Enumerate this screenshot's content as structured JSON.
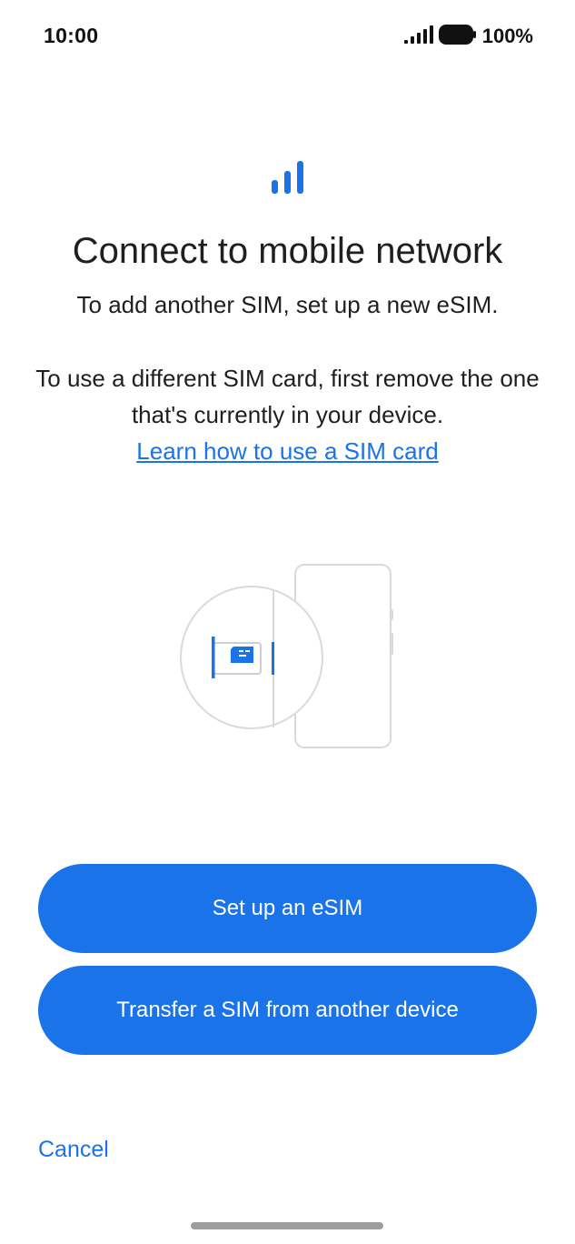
{
  "status_bar": {
    "time": "10:00",
    "battery": "100%",
    "icons": [
      "signal-icon",
      "battery-icon"
    ]
  },
  "header": {
    "icon": "signal-bars-icon",
    "title": "Connect to mobile network"
  },
  "body": {
    "line1": "To add another SIM, set up a new eSIM.",
    "line2": "To use a different SIM card, first remove the one that's currently in your device.",
    "link": "Learn how to use a SIM card"
  },
  "illustration": {
    "icon": "sim-card-tray-illustration"
  },
  "actions": {
    "setup_esim": "Set up an eSIM",
    "transfer_sim": "Transfer a SIM from another device",
    "cancel": "Cancel"
  },
  "colors": {
    "accent": "#1a73e8",
    "text": "#1f1f1f",
    "background": "#ffffff"
  }
}
